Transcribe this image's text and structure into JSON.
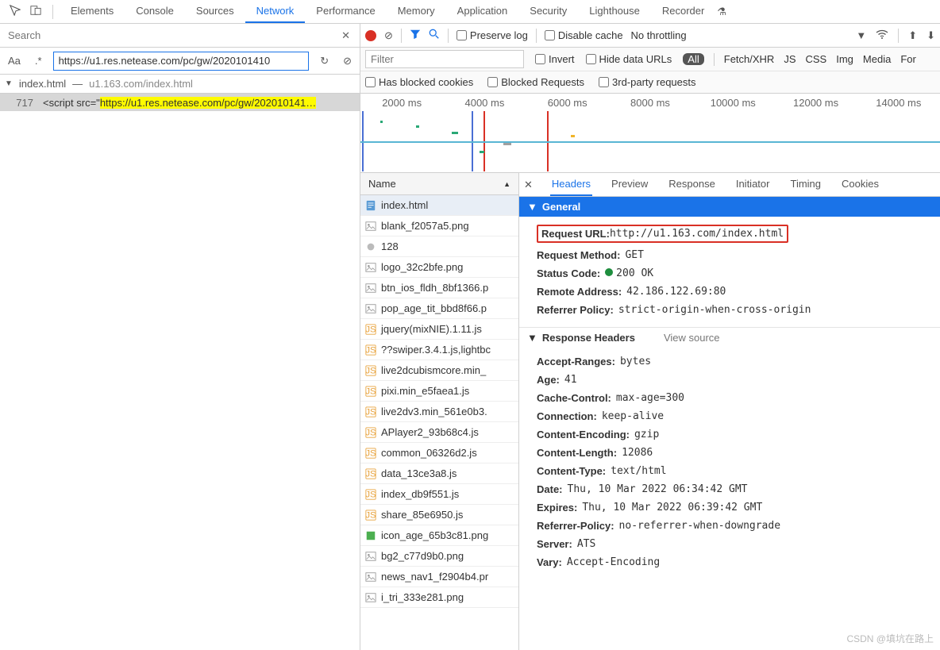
{
  "tabs": {
    "items": [
      "Elements",
      "Console",
      "Sources",
      "Network",
      "Performance",
      "Memory",
      "Application",
      "Security",
      "Lighthouse",
      "Recorder"
    ],
    "active": "Network"
  },
  "search": {
    "placeholder": "Search",
    "aa": "Aa",
    "regex": ".*",
    "url_value": "https://u1.res.netease.com/pc/gw/2020101410",
    "file": "index.html",
    "file_path": "u1.163.com/index.html",
    "line_no": "717",
    "prefix": "<script src=\"",
    "match": "https://u1.res.netease.com/pc/gw/202010141…"
  },
  "toolbar": {
    "preserve": "Preserve log",
    "disable_cache": "Disable cache",
    "throttle": "No throttling"
  },
  "filters": {
    "filter_ph": "Filter",
    "invert": "Invert",
    "hide": "Hide data URLs",
    "types": [
      "All",
      "Fetch/XHR",
      "JS",
      "CSS",
      "Img",
      "Media",
      "For"
    ],
    "blocked_cookies": "Has blocked cookies",
    "blocked_req": "Blocked Requests",
    "third": "3rd-party requests"
  },
  "timeline": {
    "ticks": [
      "2000 ms",
      "4000 ms",
      "6000 ms",
      "8000 ms",
      "10000 ms",
      "12000 ms",
      "14000 ms"
    ]
  },
  "reqlist": {
    "header": "Name",
    "items": [
      {
        "n": "index.html",
        "t": "doc"
      },
      {
        "n": "blank_f2057a5.png",
        "t": "img"
      },
      {
        "n": "128",
        "t": "other"
      },
      {
        "n": "logo_32c2bfe.png",
        "t": "img"
      },
      {
        "n": "btn_ios_fldh_8bf1366.p",
        "t": "img"
      },
      {
        "n": "pop_age_tit_bbd8f66.p",
        "t": "img"
      },
      {
        "n": "jquery(mixNIE).1.11.js",
        "t": "js"
      },
      {
        "n": "??swiper.3.4.1.js,lightbc",
        "t": "js"
      },
      {
        "n": "live2dcubismcore.min_",
        "t": "js"
      },
      {
        "n": "pixi.min_e5faea1.js",
        "t": "js"
      },
      {
        "n": "live2dv3.min_561e0b3.",
        "t": "js"
      },
      {
        "n": "APlayer2_93b68c4.js",
        "t": "js"
      },
      {
        "n": "common_06326d2.js",
        "t": "js"
      },
      {
        "n": "data_13ce3a8.js",
        "t": "js"
      },
      {
        "n": "index_db9f551.js",
        "t": "js"
      },
      {
        "n": "share_85e6950.js",
        "t": "js"
      },
      {
        "n": "icon_age_65b3c81.png",
        "t": "img2"
      },
      {
        "n": "bg2_c77d9b0.png",
        "t": "img"
      },
      {
        "n": "news_nav1_f2904b4.pr",
        "t": "img"
      },
      {
        "n": "i_tri_333e281.png",
        "t": "img"
      }
    ]
  },
  "detail_tabs": [
    "Headers",
    "Preview",
    "Response",
    "Initiator",
    "Timing",
    "Cookies"
  ],
  "general": {
    "title": "General",
    "rows": [
      {
        "k": "Request URL:",
        "v": "http://u1.163.com/index.html",
        "boxed": true
      },
      {
        "k": "Request Method:",
        "v": "GET"
      },
      {
        "k": "Status Code:",
        "v": "200 OK",
        "dot": true
      },
      {
        "k": "Remote Address:",
        "v": "42.186.122.69:80"
      },
      {
        "k": "Referrer Policy:",
        "v": "strict-origin-when-cross-origin"
      }
    ]
  },
  "response_headers": {
    "title": "Response Headers",
    "view_source": "View source",
    "rows": [
      {
        "k": "Accept-Ranges:",
        "v": "bytes"
      },
      {
        "k": "Age:",
        "v": "41"
      },
      {
        "k": "Cache-Control:",
        "v": "max-age=300"
      },
      {
        "k": "Connection:",
        "v": "keep-alive"
      },
      {
        "k": "Content-Encoding:",
        "v": "gzip"
      },
      {
        "k": "Content-Length:",
        "v": "12086"
      },
      {
        "k": "Content-Type:",
        "v": "text/html"
      },
      {
        "k": "Date:",
        "v": "Thu, 10 Mar 2022 06:34:42 GMT"
      },
      {
        "k": "Expires:",
        "v": "Thu, 10 Mar 2022 06:39:42 GMT"
      },
      {
        "k": "Referrer-Policy:",
        "v": "no-referrer-when-downgrade"
      },
      {
        "k": "Server:",
        "v": "ATS"
      },
      {
        "k": "Vary:",
        "v": "Accept-Encoding"
      }
    ]
  },
  "watermark": "CSDN @填坑在路上"
}
